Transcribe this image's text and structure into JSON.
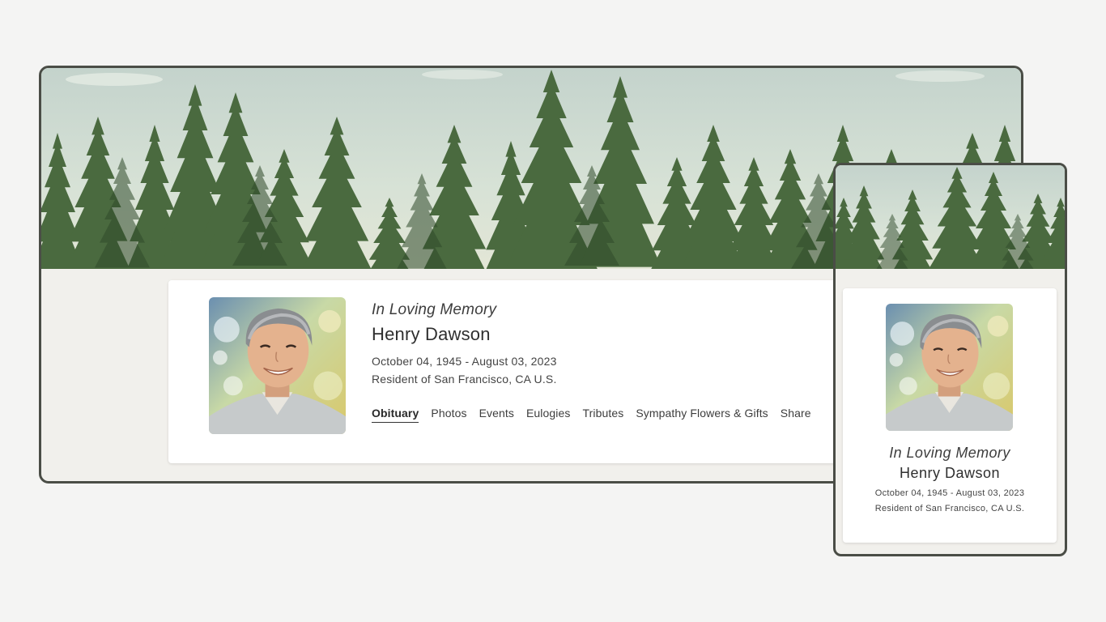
{
  "memorial": {
    "tagline": "In Loving Memory",
    "name": "Henry Dawson",
    "dates": "October 04, 1945 - August 03, 2023",
    "residence": "Resident of San Francisco, CA U.S."
  },
  "tabs": [
    {
      "label": "Obituary",
      "active": true
    },
    {
      "label": "Photos",
      "active": false
    },
    {
      "label": "Events",
      "active": false
    },
    {
      "label": "Eulogies",
      "active": false
    },
    {
      "label": "Tributes",
      "active": false
    },
    {
      "label": "Sympathy Flowers & Gifts",
      "active": false
    },
    {
      "label": "Share",
      "active": false
    }
  ],
  "colors": {
    "frame_border": "#4a4d46",
    "page_background": "#f1f0ec",
    "sky": "#c9d8cf",
    "forest": "#3f5a36"
  }
}
